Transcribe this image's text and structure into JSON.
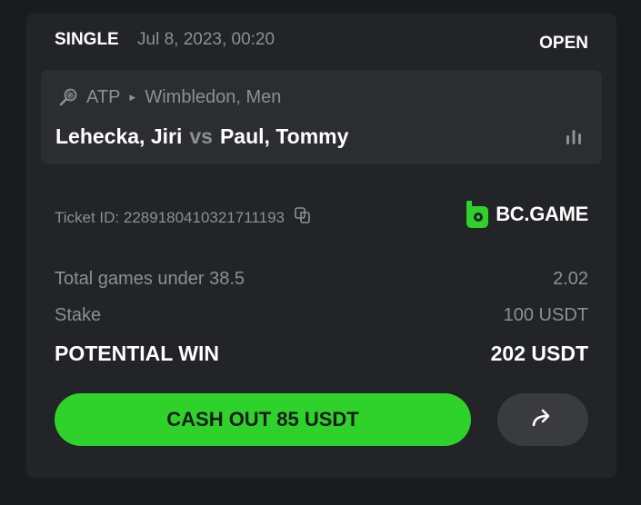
{
  "header": {
    "bet_type": "SINGLE",
    "datetime": "Jul 8, 2023, 00:20",
    "status": "OPEN"
  },
  "event": {
    "sport_icon": "tennis-racket-icon",
    "category": "ATP",
    "tournament": "Wimbledon, Men",
    "home": "Lehecka, Jiri",
    "vs": "vs",
    "away": "Paul, Tommy"
  },
  "ticket": {
    "label": "Ticket ID: 228918041032171119​3",
    "copy_icon": "copy-icon"
  },
  "brand": {
    "name": "BC.GAME",
    "accent": "#2ed22a"
  },
  "selection": {
    "name": "Total games under 38.5",
    "odds": "2.02"
  },
  "stake": {
    "label": "Stake",
    "value": "100 USDT"
  },
  "potential_win": {
    "label": "POTENTIAL WIN",
    "value": "202 USDT"
  },
  "actions": {
    "cashout_label": "CASH OUT 85 USDT",
    "share_icon": "share-arrow-icon"
  }
}
